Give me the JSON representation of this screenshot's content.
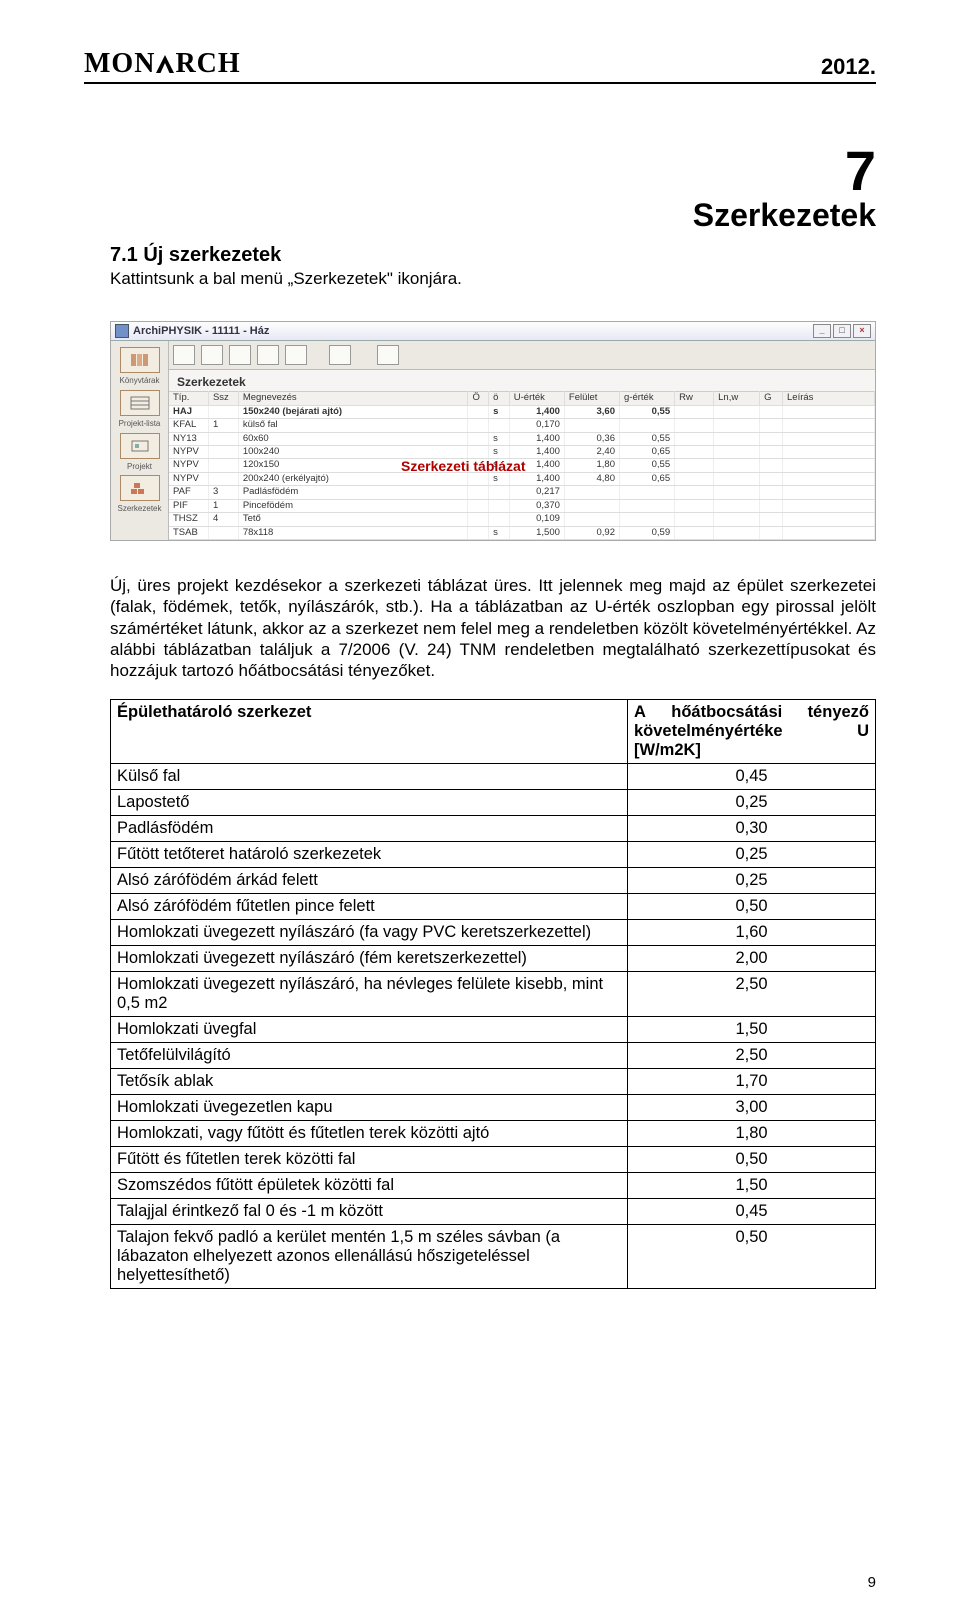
{
  "header": {
    "logo_pre": "MON",
    "logo_post": "RCH",
    "year": "2012."
  },
  "chapter": {
    "num": "7",
    "title": "Szerkezetek"
  },
  "section": {
    "num_title": "7.1 Új szerkezetek",
    "intro": "Kattintsunk a bal menü „Szerkezetek\" ikonjára."
  },
  "screenshot": {
    "title": "ArchiPHYSIK - 11111 - Ház",
    "heading": "Szerkezetek",
    "annotation": "Szerkezeti táblázat",
    "sidebar": [
      {
        "label": "Könyvtárak"
      },
      {
        "label": "Projekt-lista"
      },
      {
        "label": "Projekt"
      },
      {
        "label": "Szerkezetek"
      }
    ],
    "columns": [
      "Típ.",
      "Ssz",
      "Megnevezés",
      "Ö",
      "ö",
      "U-érték",
      "Felület",
      "g-érték",
      "Rw",
      "Ln,w",
      "G",
      "Leírás"
    ],
    "rows": [
      {
        "tip": "HAJ",
        "ssz": "",
        "meg": "150x240 (bejárati ajtó)",
        "o": "",
        "oo": "s",
        "u": "1,400",
        "fel": "3,60",
        "g": "0,55",
        "rw": "",
        "ln": "",
        "gg": "",
        "le": "",
        "bold": true
      },
      {
        "tip": "KFAL",
        "ssz": "1",
        "meg": "külső fal",
        "o": "",
        "oo": "",
        "u": "0,170",
        "fel": "",
        "g": "",
        "rw": "",
        "ln": "",
        "gg": "",
        "le": ""
      },
      {
        "tip": "NY13",
        "ssz": "",
        "meg": "60x60",
        "o": "",
        "oo": "s",
        "u": "1,400",
        "fel": "0,36",
        "g": "0,55",
        "rw": "",
        "ln": "",
        "gg": "",
        "le": ""
      },
      {
        "tip": "NYPV",
        "ssz": "",
        "meg": "100x240",
        "o": "",
        "oo": "s",
        "u": "1,400",
        "fel": "2,40",
        "g": "0,65",
        "rw": "",
        "ln": "",
        "gg": "",
        "le": ""
      },
      {
        "tip": "NYPV",
        "ssz": "",
        "meg": "120x150",
        "o": "",
        "oo": "s",
        "u": "1,400",
        "fel": "1,80",
        "g": "0,55",
        "rw": "",
        "ln": "",
        "gg": "",
        "le": ""
      },
      {
        "tip": "NYPV",
        "ssz": "",
        "meg": "200x240 (erkélyajtó)",
        "o": "",
        "oo": "s",
        "u": "1,400",
        "fel": "4,80",
        "g": "0,65",
        "rw": "",
        "ln": "",
        "gg": "",
        "le": ""
      },
      {
        "tip": "PAF",
        "ssz": "3",
        "meg": "Padlásfödém",
        "o": "",
        "oo": "",
        "u": "0,217",
        "fel": "",
        "g": "",
        "rw": "",
        "ln": "",
        "gg": "",
        "le": ""
      },
      {
        "tip": "PIF",
        "ssz": "1",
        "meg": "Pincefödém",
        "o": "",
        "oo": "",
        "u": "0,370",
        "fel": "",
        "g": "",
        "rw": "",
        "ln": "",
        "gg": "",
        "le": ""
      },
      {
        "tip": "THSZ",
        "ssz": "4",
        "meg": "Tető",
        "o": "",
        "oo": "",
        "u": "0,109",
        "fel": "",
        "g": "",
        "rw": "",
        "ln": "",
        "gg": "",
        "le": ""
      },
      {
        "tip": "TSAB",
        "ssz": "",
        "meg": "78x118",
        "o": "",
        "oo": "s",
        "u": "1,500",
        "fel": "0,92",
        "g": "0,59",
        "rw": "",
        "ln": "",
        "gg": "",
        "le": ""
      }
    ]
  },
  "body_para": "Új, üres projekt kezdésekor a szerkezeti táblázat üres. Itt jelennek meg majd az épület szerkezetei (falak, födémek, tetők, nyílászárók, stb.). Ha a táblázatban az U-érték oszlopban egy pirossal jelölt számértéket látunk, akkor az a szerkezet nem felel meg a rendeletben közölt követelményértékkel. Az alábbi táblázatban találjuk a 7/2006 (V. 24) TNM rendeletben megtalálható szerkezettípusokat és hozzájuk tartozó hőátbocsátási tényezőket.",
  "req_table": {
    "head_left": "Épülethatároló szerkezet",
    "head_right_l1": "A hőátbocsátási tényező",
    "head_right_l2": "követelményértéke U [W/m2K]",
    "rows": [
      {
        "name": "Külső fal",
        "val": "0,45"
      },
      {
        "name": "Lapostető",
        "val": "0,25"
      },
      {
        "name": "Padlásfödém",
        "val": "0,30"
      },
      {
        "name": "Fűtött tetőteret határoló szerkezetek",
        "val": "0,25"
      },
      {
        "name": "Alsó zárófödém árkád felett",
        "val": "0,25"
      },
      {
        "name": "Alsó zárófödém fűtetlen pince felett",
        "val": "0,50"
      },
      {
        "name": "Homlokzati üvegezett nyílászáró (fa vagy PVC keretszerkezettel)",
        "val": "1,60"
      },
      {
        "name": "Homlokzati üvegezett nyílászáró (fém keretszerkezettel)",
        "val": "2,00"
      },
      {
        "name": "Homlokzati üvegezett nyílászáró, ha névleges felülete kisebb, mint 0,5 m2",
        "val": "2,50"
      },
      {
        "name": "Homlokzati üvegfal",
        "val": "1,50"
      },
      {
        "name": "Tetőfelülvilágító",
        "val": "2,50"
      },
      {
        "name": "Tetősík ablak",
        "val": "1,70"
      },
      {
        "name": "Homlokzati üvegezetlen kapu",
        "val": "3,00"
      },
      {
        "name": "Homlokzati, vagy fűtött és fűtetlen terek közötti ajtó",
        "val": "1,80"
      },
      {
        "name": "Fűtött és fűtetlen terek közötti fal",
        "val": "0,50"
      },
      {
        "name": "Szomszédos fűtött épületek közötti fal",
        "val": "1,50"
      },
      {
        "name": "Talajjal érintkező fal  0 és -1 m között",
        "val": "0,45"
      },
      {
        "name": "Talajon fekvő padló a kerület mentén 1,5 m széles sávban (a lábazaton elhelyezett azonos ellenállású hőszigeteléssel helyettesíthető)",
        "val": "0,50"
      }
    ]
  },
  "page_num": "9"
}
